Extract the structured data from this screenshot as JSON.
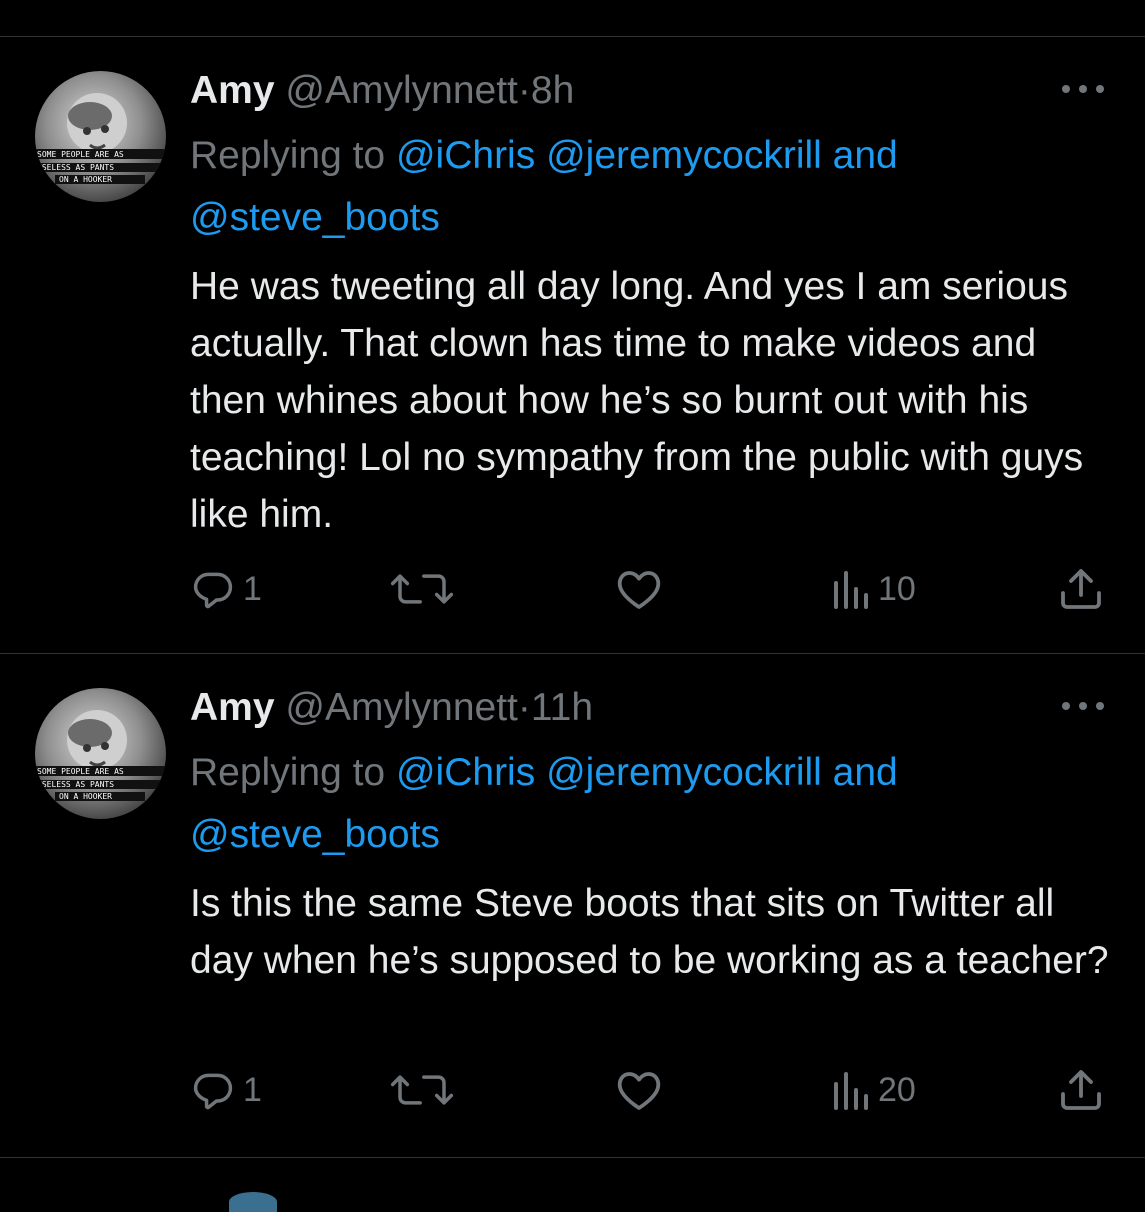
{
  "tweets": [
    {
      "display_name": "Amy",
      "handle": "@Amylynnett",
      "separator": "·",
      "time": "8h",
      "avatar_caption": "SOME PEOPLE ARE AS USELESS AS PANTS ON A HOOKER",
      "replying_prefix": "Replying to ",
      "mentions": [
        "@iChris",
        "@jeremycockrill"
      ],
      "replying_and": " and",
      "mention_last": "@steve_boots",
      "text": "He was tweeting all day long. And yes I am serious actually. That clown has time to make videos and then whines about how he’s so burnt out with his teaching! Lol no sympathy from the public with guys like him.",
      "stats": {
        "replies": "1",
        "views": "10"
      }
    },
    {
      "display_name": "Amy",
      "handle": "@Amylynnett",
      "separator": "·",
      "time": "11h",
      "avatar_caption": "SOME PEOPLE ARE AS USELESS AS PANTS ON A HOOKER",
      "replying_prefix": "Replying to ",
      "mentions": [
        "@iChris",
        "@jeremycockrill"
      ],
      "replying_and": " and",
      "mention_last": "@steve_boots",
      "text": "Is this the same Steve boots that sits on Twitter all day when he’s supposed to be working as a teacher?",
      "stats": {
        "replies": "1",
        "views": "20"
      }
    }
  ],
  "icons": {
    "reply": "reply-icon",
    "retweet": "retweet-icon",
    "like": "heart-icon",
    "views": "views-icon",
    "share": "share-icon",
    "more": "more-icon"
  },
  "colors": {
    "background": "#000000",
    "text": "#e7e9ea",
    "muted": "#71767b",
    "accent": "#1d9bf0",
    "divider": "#2f3336"
  }
}
